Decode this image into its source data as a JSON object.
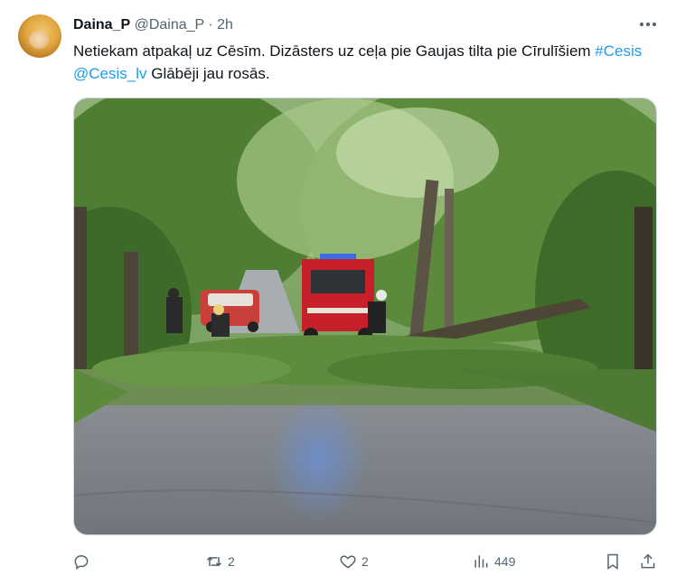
{
  "author": {
    "display_name": "Daina_P",
    "handle": "@Daina_P",
    "separator": "·",
    "time": "2h"
  },
  "tweet": {
    "text_part1": "Netiekam atpakaļ uz Cēsīm. Dizāsters uz ceļa pie Gaujas tilta pie Cīrulīšiem ",
    "hashtag": "#Cesis",
    "space": " ",
    "mention": "@Cesis_lv",
    "text_part2": " Glābēji jau rosās."
  },
  "media": {
    "icon": "photo-fallen-tree-fire-truck"
  },
  "actions": {
    "reply_count": "",
    "retweet_count": "2",
    "like_count": "2",
    "views_count": "449"
  },
  "colors": {
    "accent": "#1d9bf0",
    "secondary_text": "#536471",
    "primary_text": "#0f1419"
  }
}
